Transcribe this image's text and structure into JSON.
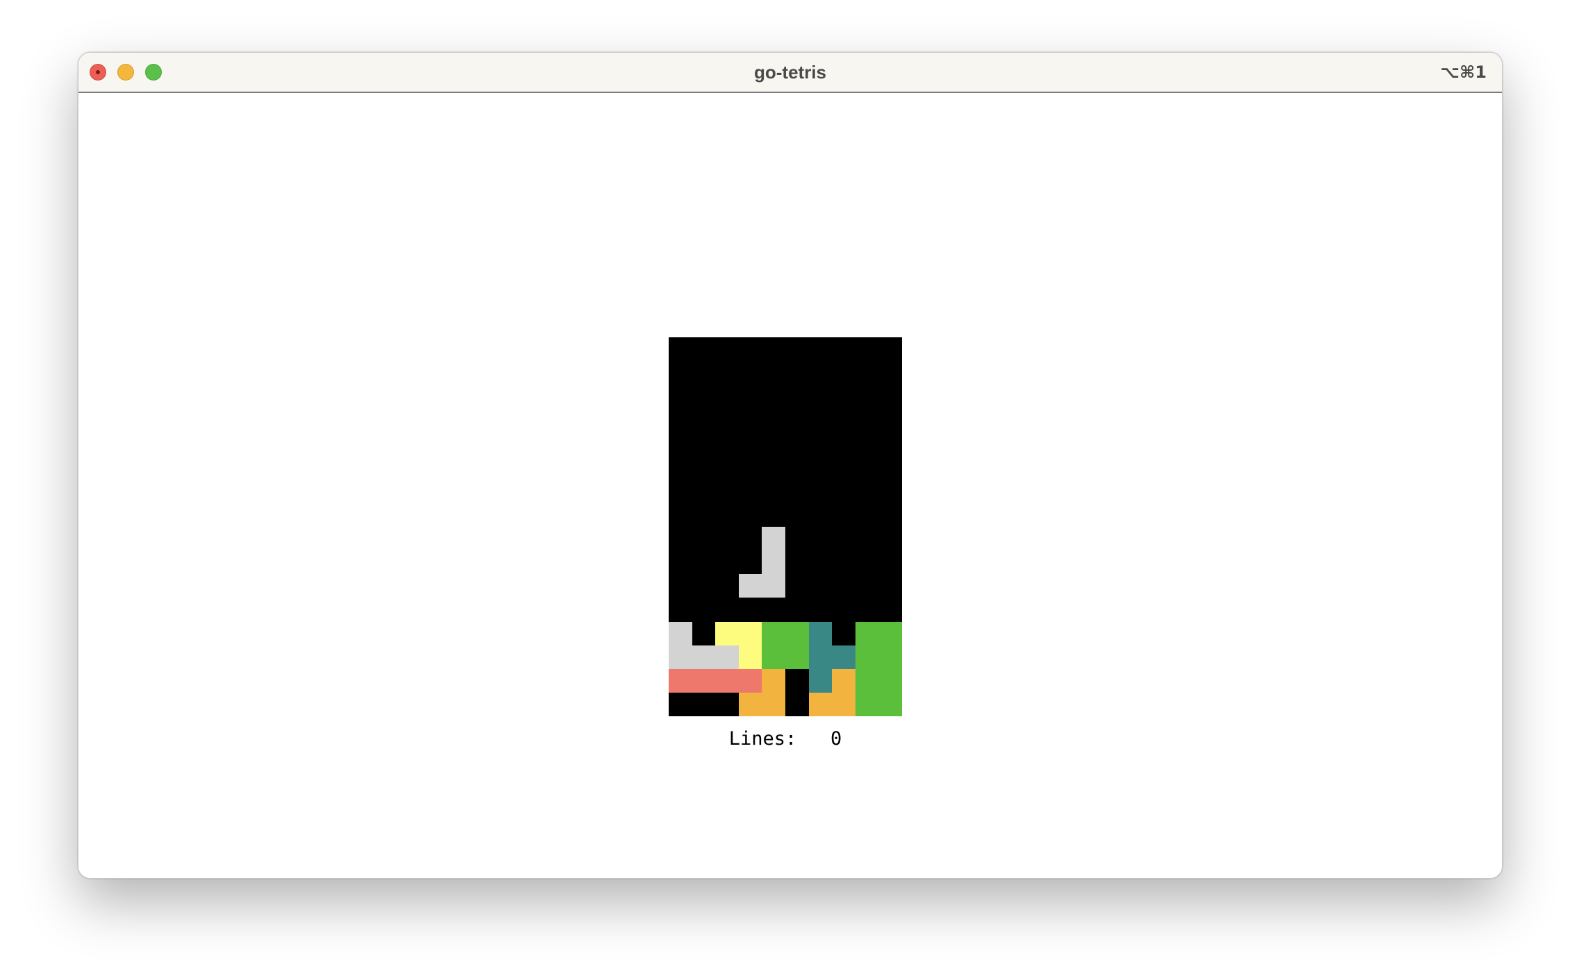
{
  "window": {
    "title": "go-tetris",
    "shortcut": "⌥⌘1"
  },
  "game": {
    "columns": 10,
    "rows": 16,
    "lines_label": "Lines:",
    "lines_value": "0",
    "colors": {
      "gray": "#d3d3d3",
      "yellow": "#fdfc7f",
      "green": "#5bbf3b",
      "teal": "#3a8886",
      "orange": "#f3b33f",
      "salmon": "#ed786b"
    },
    "falling_piece": {
      "color": "gray",
      "cells": [
        [
          4,
          8
        ],
        [
          4,
          9
        ],
        [
          3,
          10
        ],
        [
          4,
          10
        ]
      ]
    },
    "stack": [
      {
        "col": 0,
        "row": 12,
        "color": "gray"
      },
      {
        "col": 2,
        "row": 12,
        "color": "yellow"
      },
      {
        "col": 3,
        "row": 12,
        "color": "yellow"
      },
      {
        "col": 4,
        "row": 12,
        "color": "green"
      },
      {
        "col": 5,
        "row": 12,
        "color": "green"
      },
      {
        "col": 6,
        "row": 12,
        "color": "teal"
      },
      {
        "col": 8,
        "row": 12,
        "color": "green"
      },
      {
        "col": 9,
        "row": 12,
        "color": "green"
      },
      {
        "col": 0,
        "row": 13,
        "color": "gray"
      },
      {
        "col": 1,
        "row": 13,
        "color": "gray"
      },
      {
        "col": 2,
        "row": 13,
        "color": "gray"
      },
      {
        "col": 3,
        "row": 13,
        "color": "yellow"
      },
      {
        "col": 4,
        "row": 13,
        "color": "yellow"
      },
      {
        "col": 5,
        "row": 13,
        "color": "green"
      },
      {
        "col": 4,
        "row": 13,
        "color": "green"
      },
      {
        "col": 6,
        "row": 13,
        "color": "teal"
      },
      {
        "col": 7,
        "row": 13,
        "color": "teal"
      },
      {
        "col": 8,
        "row": 13,
        "color": "green"
      },
      {
        "col": 9,
        "row": 13,
        "color": "green"
      },
      {
        "col": 0,
        "row": 14,
        "color": "salmon"
      },
      {
        "col": 1,
        "row": 14,
        "color": "salmon"
      },
      {
        "col": 2,
        "row": 14,
        "color": "salmon"
      },
      {
        "col": 3,
        "row": 14,
        "color": "salmon"
      },
      {
        "col": 4,
        "row": 14,
        "color": "orange"
      },
      {
        "col": 6,
        "row": 14,
        "color": "teal"
      },
      {
        "col": 7,
        "row": 14,
        "color": "orange"
      },
      {
        "col": 8,
        "row": 14,
        "color": "orange"
      },
      {
        "col": 9,
        "row": 14,
        "color": "green"
      },
      {
        "col": 8,
        "row": 14,
        "color": "green"
      },
      {
        "col": 3,
        "row": 15,
        "color": "orange"
      },
      {
        "col": 4,
        "row": 15,
        "color": "orange"
      },
      {
        "col": 6,
        "row": 15,
        "color": "orange"
      },
      {
        "col": 7,
        "row": 15,
        "color": "orange"
      },
      {
        "col": 8,
        "row": 15,
        "color": "green"
      },
      {
        "col": 9,
        "row": 15,
        "color": "green"
      }
    ]
  }
}
